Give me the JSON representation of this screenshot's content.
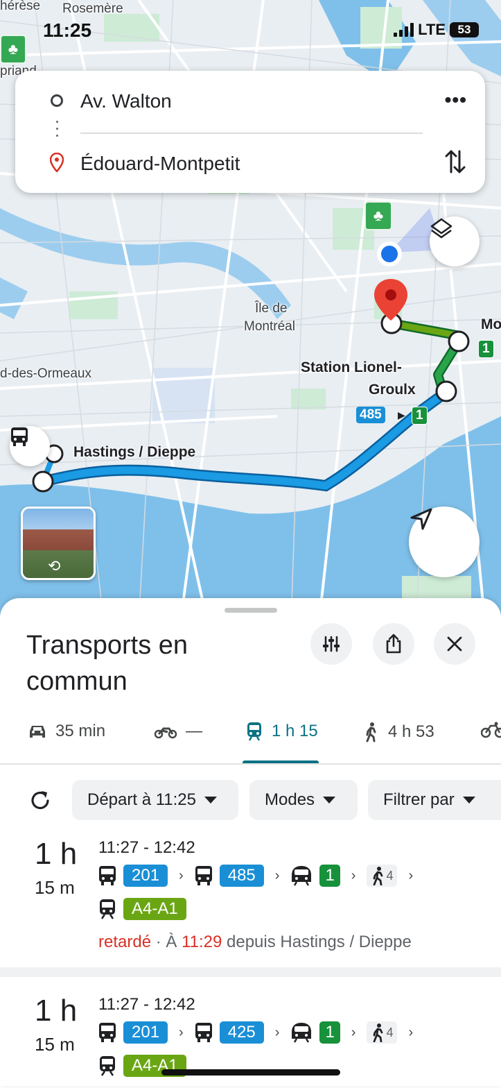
{
  "status_bar": {
    "time": "11:25",
    "network": "LTE",
    "battery": "53"
  },
  "route": {
    "origin": "Av. Walton",
    "destination": "Édouard-Montpetit"
  },
  "icons": {
    "more": "more-horiz-icon",
    "swap": "swap-vertical-icon",
    "layers": "layers-icon",
    "navigate": "navigation-arrow-icon",
    "filters": "tune-icon",
    "share": "share-icon",
    "close": "close-icon"
  },
  "map": {
    "labels": {
      "top_left_a": "hérèse",
      "top_left_b": "Rosemère",
      "left_partial": "priand",
      "island_1": "Île de",
      "island_2": "Montréal",
      "ormeaux": "d-des-Ormeaux",
      "station_1": "Station Lionel-",
      "station_2": "Groulx",
      "stop": "Hastings / Dieppe",
      "mo": "Mo"
    },
    "badges": {
      "bus485": "485",
      "metro1a": "1",
      "metro1b": "1"
    }
  },
  "sheet": {
    "title": "Transports en commun",
    "modes": [
      {
        "icon": "car-icon",
        "label": "35 min"
      },
      {
        "icon": "motorcycle-icon",
        "label": "—"
      },
      {
        "icon": "transit-icon",
        "label": "1 h 15"
      },
      {
        "icon": "walk-icon",
        "label": "4 h 53"
      },
      {
        "icon": "bike-icon",
        "label": ""
      }
    ],
    "chips": {
      "refresh_icon": "refresh-icon",
      "depart": "Départ à 11:25",
      "modes": "Modes",
      "filter": "Filtrer par"
    }
  },
  "results": [
    {
      "duration_h": "1 h",
      "duration_m": "15 m",
      "times": "11:27 - 12:42",
      "legs": [
        "201",
        "485",
        "1"
      ],
      "walk": "4",
      "train": "A4-A1",
      "late": "retardé",
      "dot": " · À ",
      "late_time": "11:29",
      "from": " depuis Hastings / Dieppe"
    },
    {
      "duration_h": "1 h",
      "duration_m": "15 m",
      "times": "11:27 - 12:42",
      "legs": [
        "201",
        "425",
        "1"
      ],
      "walk": "4",
      "train": "A4-A1"
    }
  ],
  "colors": {
    "bus": "#1a8fd6",
    "metro": "#17913b",
    "train": "#6aa613",
    "accent": "#0b7285",
    "late": "#d93025"
  }
}
